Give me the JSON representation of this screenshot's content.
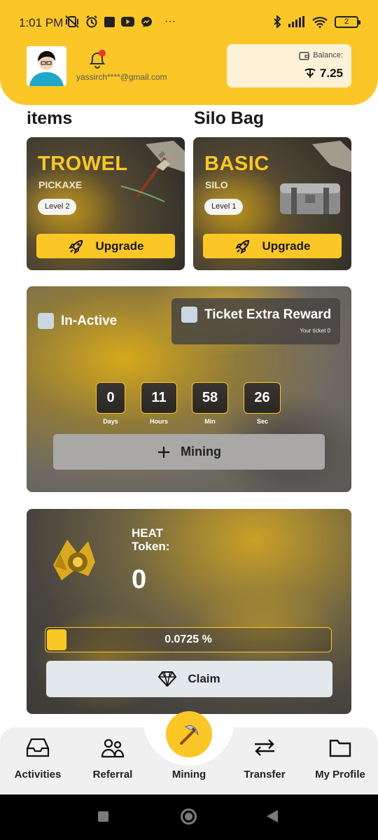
{
  "status_bar": {
    "time": "1:01 PM",
    "battery": "2",
    "more": "···"
  },
  "profile": {
    "email": "yassirch****@gmail.com"
  },
  "balance": {
    "label": "Balance:",
    "value": "7.25"
  },
  "sections": {
    "items_title": "items",
    "silo_title": "Silo Bag"
  },
  "cards": [
    {
      "title": "TROWEL",
      "subtitle": "PICKAXE",
      "level": "Level 2",
      "button": "Upgrade"
    },
    {
      "title": "BASIC",
      "subtitle": "SILO",
      "level": "Level 1",
      "button": "Upgrade"
    }
  ],
  "mining_panel": {
    "status_label": "In-Active",
    "ticket_label": "Ticket Extra Reward",
    "ticket_sub": "Your ticket 0",
    "timer": [
      {
        "value": "0",
        "label": "Days"
      },
      {
        "value": "11",
        "label": "Hours"
      },
      {
        "value": "58",
        "label": "Min"
      },
      {
        "value": "26",
        "label": "Sec"
      }
    ],
    "button": "Mining"
  },
  "heat_panel": {
    "title": "HEAT Token:",
    "value": "0",
    "progress_text": "0.0725 %",
    "progress_fraction": 0.07,
    "button": "Claim"
  },
  "bottom_nav": [
    {
      "label": "Activities",
      "icon": "inbox-icon"
    },
    {
      "label": "Referral",
      "icon": "users-icon"
    },
    {
      "label": "Mining",
      "icon": "pickaxe-icon"
    },
    {
      "label": "Transfer",
      "icon": "transfer-icon"
    },
    {
      "label": "My Profile",
      "icon": "folder-icon"
    }
  ],
  "colors": {
    "accent": "#fbc727",
    "balance_bg": "#fdf2d8",
    "nav_bg": "#f0f0f0"
  }
}
